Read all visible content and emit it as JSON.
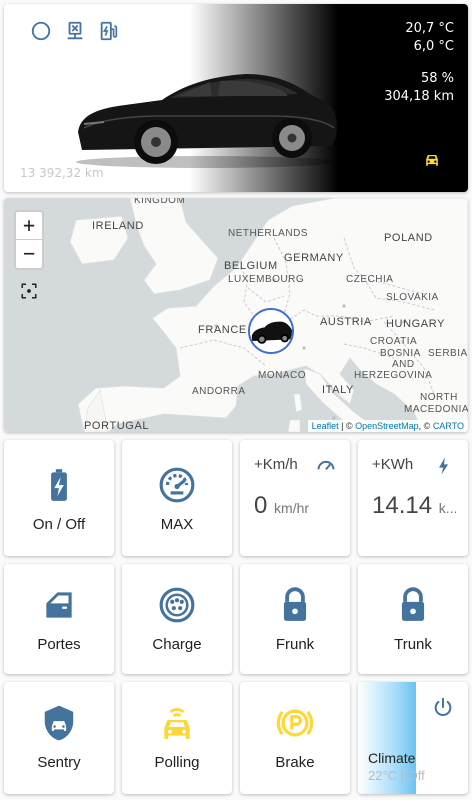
{
  "car": {
    "temp_inside": "20,7 °C",
    "temp_outside": "6,0 °C",
    "battery": "58 %",
    "range": "304,18 km",
    "odometer": "13 392,32 km"
  },
  "map": {
    "zoom_in": "+",
    "zoom_out": "−",
    "labels": {
      "kingdom": "KINGDOM",
      "ireland": "IRELAND",
      "netherlands": "NETHERLANDS",
      "poland": "POLAND",
      "belgium": "BELGIUM",
      "germany": "GERMANY",
      "luxembourg": "LUXEMBOURG",
      "czechia": "CZECHIA",
      "slovakia": "SLOVAKIA",
      "france": "FRANCE",
      "austria": "AUSTRIA",
      "hungary": "HUNGARY",
      "croatia": "CROATIA",
      "bosnia": "BOSNIA",
      "and": "AND",
      "herzegovina": "HERZEGOVINA",
      "serbia": "SERBIA",
      "monaco": "MONACO",
      "andorra": "ANDORRA",
      "italy": "ITALY",
      "north": "NORTH",
      "macedonia": "MACEDONIA",
      "portugal": "PORTUGAL"
    },
    "attribution": {
      "leaflet": "Leaflet",
      "sep1": " | © ",
      "osm": "OpenStreetMap",
      "sep2": ", © ",
      "carto": "CARTO"
    }
  },
  "tiles": {
    "onoff": "On / Off",
    "max": "MAX",
    "speed": {
      "title": "+Km/h",
      "value": "0",
      "unit": "km/hr"
    },
    "energy": {
      "title": "+KWh",
      "value": "14.14",
      "unit": "k..."
    },
    "doors": "Portes",
    "charge": "Charge",
    "frunk": "Frunk",
    "trunk": "Trunk",
    "sentry": "Sentry",
    "polling": "Polling",
    "brake": "Brake",
    "climate": {
      "name": "Climate",
      "state": "22°C | Off"
    }
  },
  "colors": {
    "icon_blue": "#44739e",
    "icon_yellow": "#fdd835",
    "climate_blue": "#6cc2ef"
  }
}
